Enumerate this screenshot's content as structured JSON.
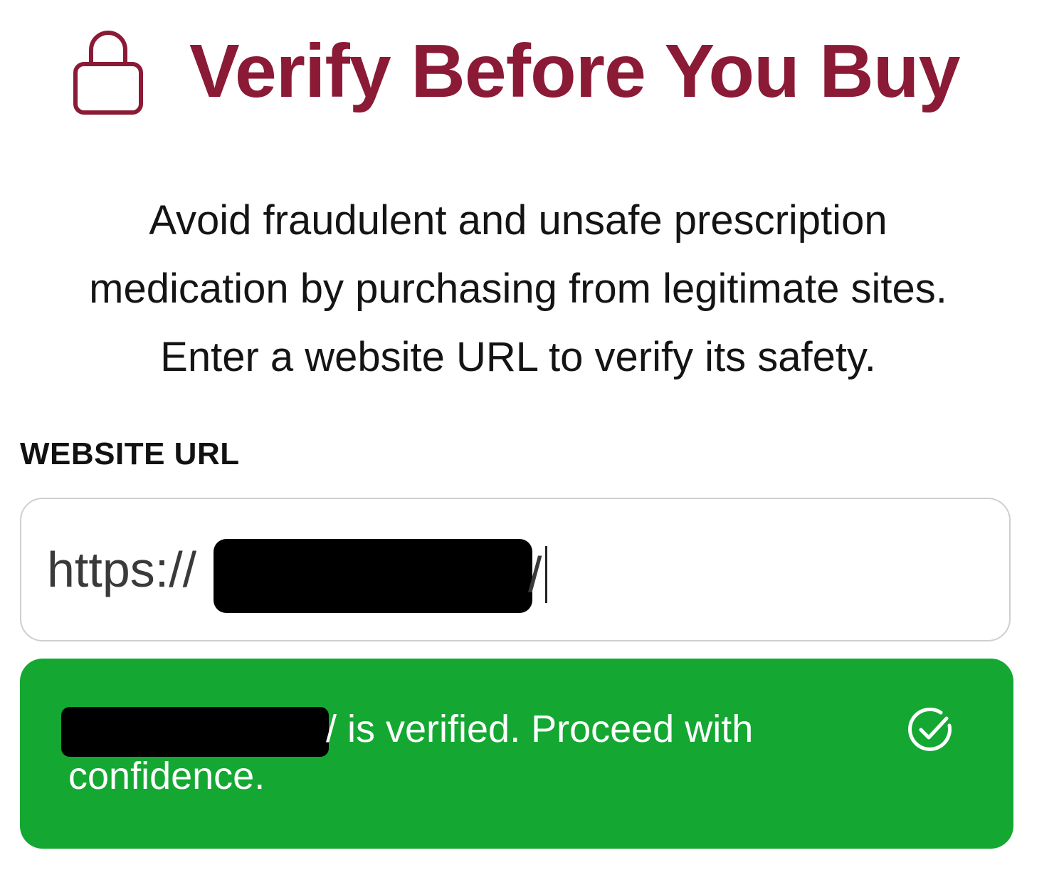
{
  "header": {
    "title": "Verify Before You Buy",
    "icon": "lock-icon"
  },
  "description": {
    "line1": "Avoid fraudulent and unsafe prescription",
    "line2": "medication by purchasing from legitimate sites.",
    "line3": "Enter a website URL to verify its safety."
  },
  "form": {
    "label": "WEBSITE URL",
    "url_prefix": "https://",
    "url_suffix": "/"
  },
  "alert": {
    "line1": "/ is verified. Proceed with",
    "line2": "confidence.",
    "icon": "check-circle-icon",
    "background": "#14a832"
  },
  "colors": {
    "brand": "#8b1a36",
    "success": "#14a832"
  }
}
